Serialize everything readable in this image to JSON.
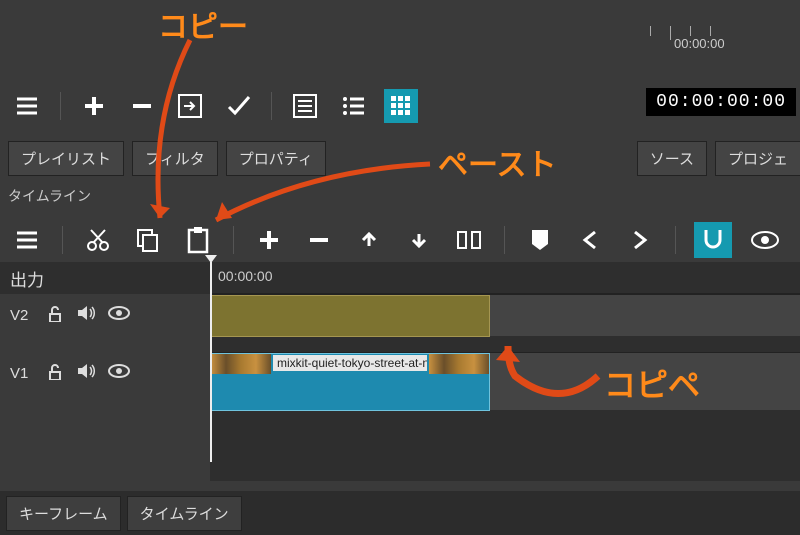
{
  "top": {
    "ruler_label": "00:00:00",
    "timecode": "00:00:00:00"
  },
  "tabs": {
    "playlist": "プレイリスト",
    "filter": "フィルタ",
    "property": "プロパティ",
    "source": "ソース",
    "project": "プロジェ"
  },
  "timeline": {
    "title": "タイムライン",
    "output_label": "出力",
    "ruler_zero": "00:00:00",
    "tracks": {
      "v2": "V2",
      "v1": "V1"
    },
    "clip_name": "mixkit-quiet-tokyo-street-at-nig"
  },
  "bottom_tabs": {
    "keyframe": "キーフレーム",
    "timeline": "タイムライン"
  },
  "annotations": {
    "copy": "コピー",
    "paste": "ペースト",
    "copipe": "コピペ"
  }
}
